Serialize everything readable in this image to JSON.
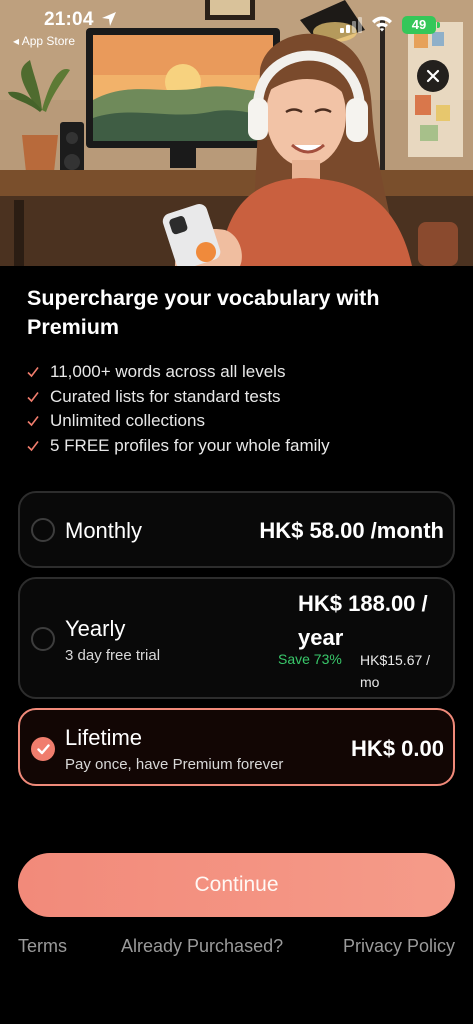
{
  "status_bar": {
    "time": "21:04",
    "back_app": "◂ App Store",
    "battery": "49"
  },
  "hero": {
    "image": "girl-with-headphones-at-desk-illustration"
  },
  "paywall": {
    "headline": "Supercharge your vocabulary with Premium",
    "features": [
      "11,000+ words across all levels",
      "Curated lists for standard tests",
      "Unlimited collections",
      "5 FREE profiles for your whole family"
    ],
    "plans": {
      "monthly": {
        "name": "Monthly",
        "price": "HK$ 58.00 /month",
        "selected": false
      },
      "yearly": {
        "name": "Yearly",
        "subtitle": "3 day free trial",
        "price": "HK$ 188.00 / year",
        "save": "Save 73%",
        "per_month": "HK$15.67 / mo",
        "selected": false
      },
      "lifetime": {
        "name": "Lifetime",
        "subtitle": "Pay once, have Premium forever",
        "price": "HK$ 0.00",
        "selected": true
      }
    },
    "continue_label": "Continue"
  },
  "footer": {
    "terms": "Terms",
    "restore": "Already Purchased?",
    "privacy": "Privacy Policy"
  },
  "colors": {
    "accent": "#f28a7a",
    "save_green": "#39c76a",
    "battery_green": "#34c759",
    "background": "#000000"
  },
  "icons": [
    "location-arrow-icon",
    "signal-icon",
    "wifi-icon",
    "close-icon",
    "check-icon",
    "radio-checked-icon"
  ]
}
